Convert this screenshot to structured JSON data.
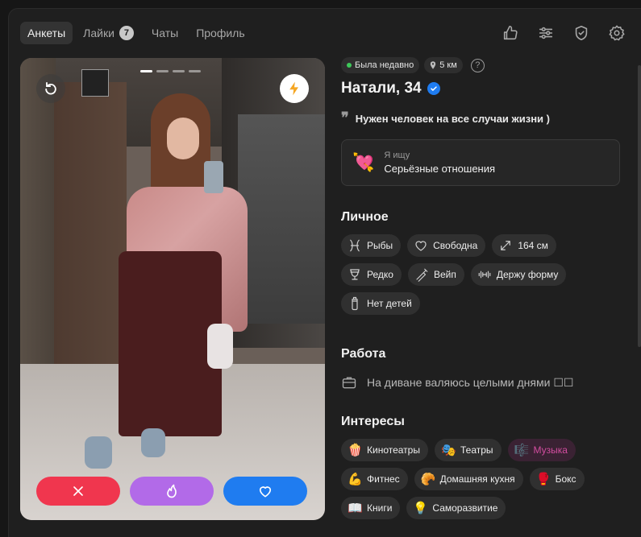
{
  "nav": {
    "tabs": [
      {
        "label": "Анкеты",
        "active": true
      },
      {
        "label": "Лайки",
        "badge": "7"
      },
      {
        "label": "Чаты"
      },
      {
        "label": "Профиль"
      }
    ],
    "icons": [
      "thumbs-up-icon",
      "sliders-icon",
      "shield-icon",
      "gear-icon"
    ]
  },
  "photo": {
    "photo_count": 4,
    "active_index": 0
  },
  "profile": {
    "status": "Была недавно",
    "distance": "5 км",
    "help": "?",
    "name": "Натали, 34",
    "quote_mark": "❞",
    "quote": "Нужен человек на все случаи жизни )",
    "seek": {
      "emoji": "💘",
      "label": "Я ищу",
      "value": "Серьёзные отношения"
    }
  },
  "personal": {
    "title": "Личное",
    "chips": [
      "Рыбы",
      "Свободна",
      "164 см",
      "Редко",
      "Вейп",
      "Держу форму",
      "Нет детей"
    ]
  },
  "work": {
    "title": "Работа",
    "text": "На диване валяюсь целыми днями ☐☐"
  },
  "interests": {
    "title": "Интересы",
    "chips": [
      {
        "emoji": "🍿",
        "label": "Кинотеатры"
      },
      {
        "emoji": "🎭",
        "label": "Театры"
      },
      {
        "emoji": "🎼",
        "label": "Музыка",
        "highlight": true
      },
      {
        "emoji": "💪",
        "label": "Фитнес"
      },
      {
        "emoji": "🥐",
        "label": "Домашняя кухня"
      },
      {
        "emoji": "🥊",
        "label": "Бокс"
      },
      {
        "emoji": "📖",
        "label": "Книги"
      },
      {
        "emoji": "💡",
        "label": "Саморазвитие"
      }
    ]
  },
  "colors": {
    "dislike": "#f0364e",
    "superlike": "#b26ae8",
    "like": "#1f7cf0",
    "online": "#3ec95a",
    "highlight_text": "#d34da0"
  }
}
